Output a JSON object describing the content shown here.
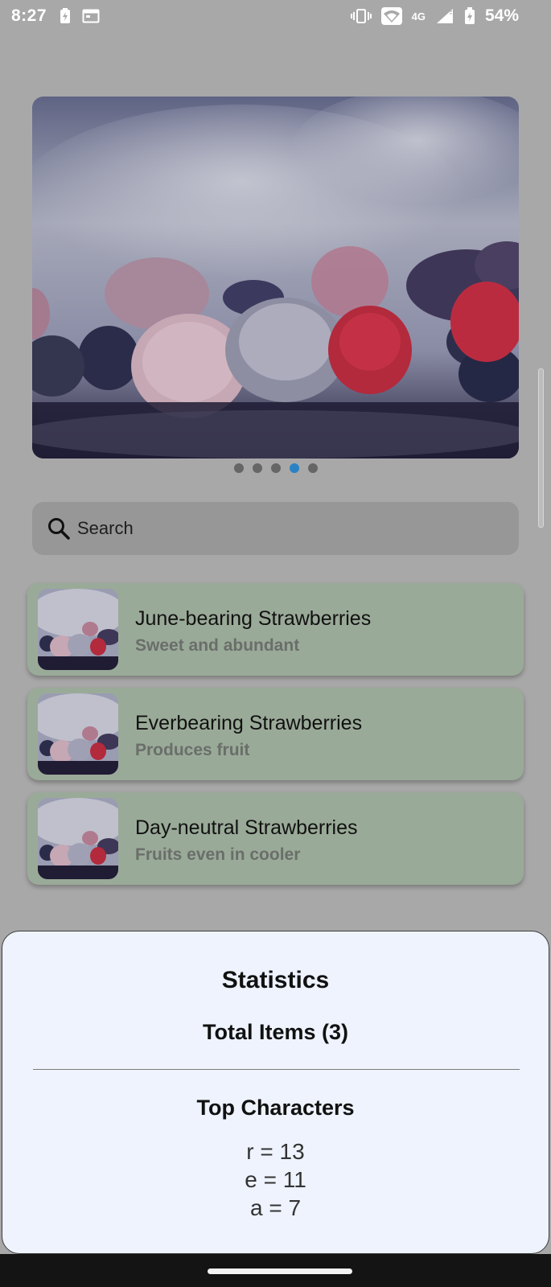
{
  "status_bar": {
    "time": "8:27",
    "network": "4G",
    "battery": "54%",
    "icons": [
      "battery-saver-icon",
      "calendar-icon",
      "vibrate-icon",
      "wifi-icon",
      "signal-icon",
      "battery-icon"
    ]
  },
  "carousel": {
    "image": "frozen berries",
    "page_count": 5,
    "active_index": 3
  },
  "search": {
    "placeholder": "Search",
    "value": ""
  },
  "list": {
    "items": [
      {
        "title": "June-bearing Strawberries",
        "subtitle": "Sweet and abundant"
      },
      {
        "title": "Everbearing Strawberries",
        "subtitle": "Produces fruit"
      },
      {
        "title": "Day-neutral Strawberries",
        "subtitle": "Fruits even in cooler"
      }
    ]
  },
  "statistics": {
    "title": "Statistics",
    "total": "Total Items (3)",
    "top_title": "Top Characters",
    "chars": [
      "r = 13",
      "e = 11",
      "a = 7"
    ]
  },
  "colors": {
    "overlay_background": "#a8a8a8",
    "card": "#9aaa98",
    "sheet": "#eef3fd",
    "active_dot": "#2a82c4"
  }
}
